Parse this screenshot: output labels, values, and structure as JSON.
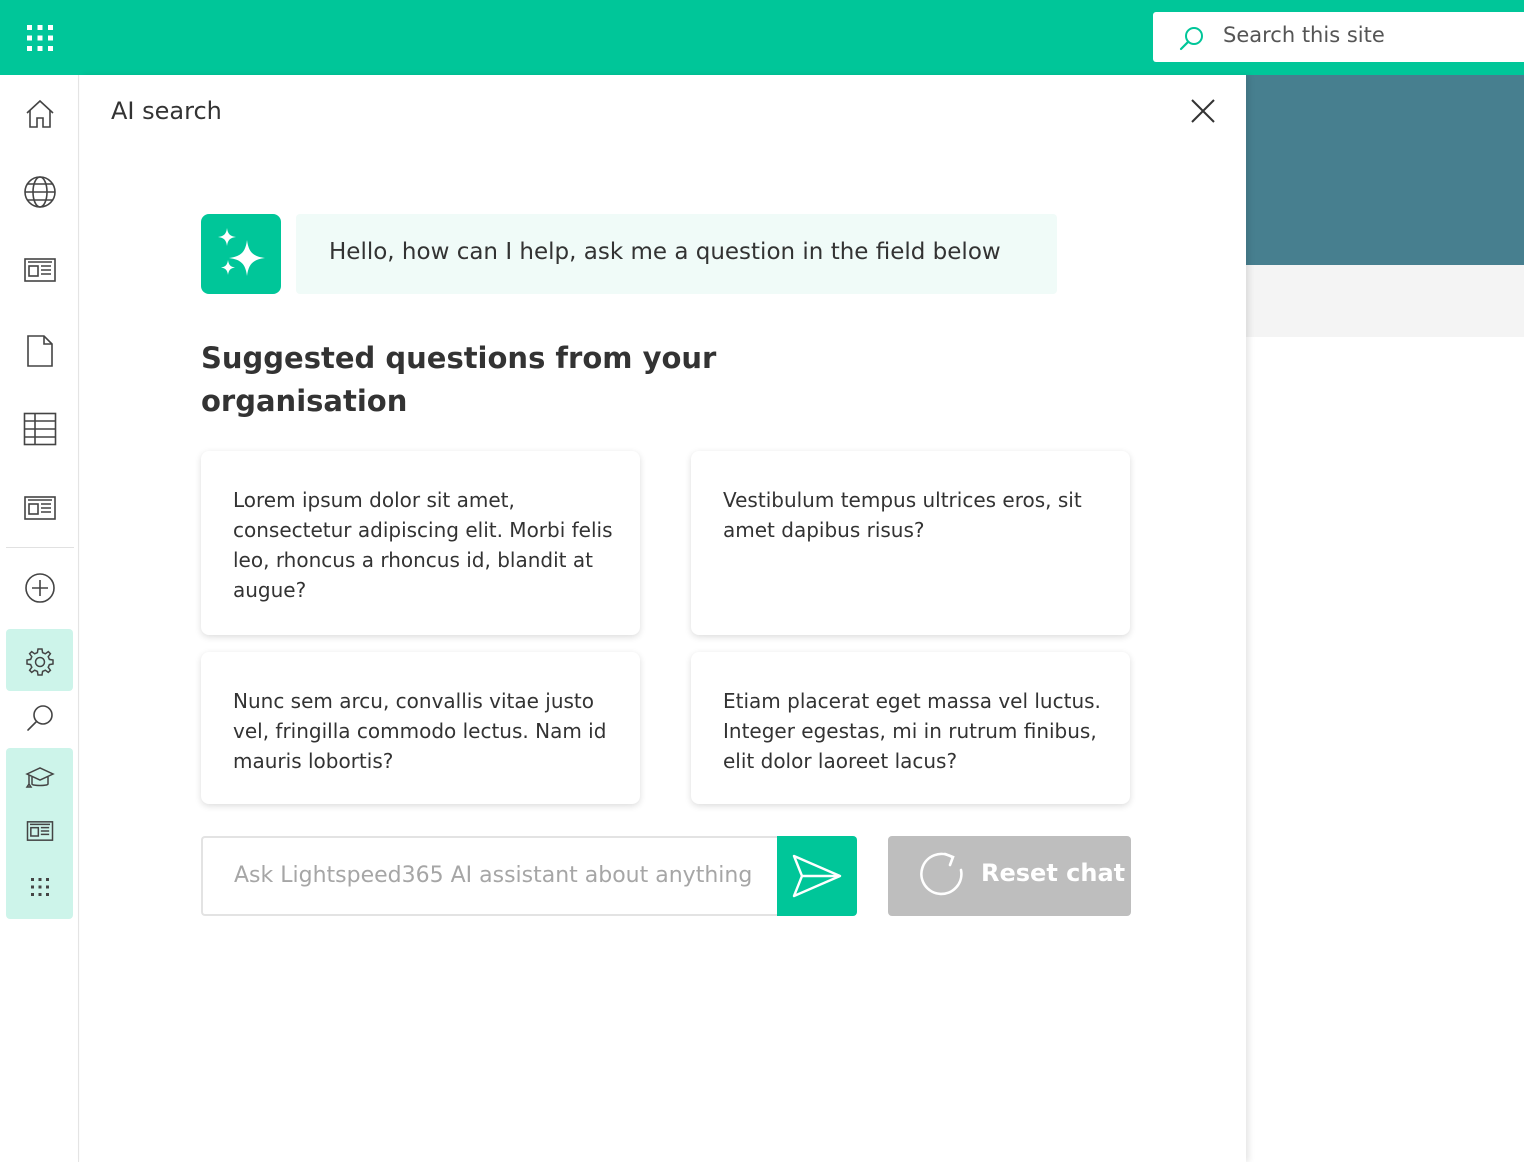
{
  "colors": {
    "brand": "#00c699",
    "brand_light": "#cdf4ea",
    "header_band": "#477f8f",
    "reset_gray": "#bebebe"
  },
  "topbar": {
    "app_launcher_icon": "waffle-icon",
    "search": {
      "icon": "search-icon",
      "placeholder": "Search this site"
    }
  },
  "leftrail": {
    "items": [
      {
        "icon": "home-icon"
      },
      {
        "icon": "globe-icon"
      },
      {
        "icon": "news-icon"
      },
      {
        "icon": "document-icon"
      },
      {
        "icon": "table-icon"
      },
      {
        "icon": "news-icon"
      },
      {
        "icon": "add-circle-icon"
      },
      {
        "icon": "gear-icon"
      },
      {
        "icon": "search-icon"
      },
      {
        "icon": "graduation-cap-icon"
      },
      {
        "icon": "news-icon"
      },
      {
        "icon": "waffle-icon"
      }
    ]
  },
  "panel": {
    "title": "AI search",
    "close_icon": "close-icon",
    "bot_avatar_icon": "sparkle-icon",
    "greeting": "Hello, how can I help, ask me a question in the field below",
    "suggested_heading": "Suggested questions from your organisation",
    "suggestions": [
      "Lorem ipsum dolor sit amet, consectetur adipiscing elit. Morbi felis leo, rhoncus a rhoncus id, blandit at augue?",
      "Vestibulum tempus ultrices eros, sit amet dapibus risus?",
      "Nunc sem arcu, convallis vitae justo vel, fringilla commodo lectus. Nam id mauris lobortis?",
      "Etiam placerat eget massa vel luctus. Integer egestas, mi in rutrum finibus, elit dolor laoreet lacus?"
    ],
    "input_placeholder": "Ask Lightspeed365 AI assistant about anything",
    "send_icon": "send-icon",
    "reset": {
      "icon": "refresh-icon",
      "label": "Reset chat"
    }
  }
}
